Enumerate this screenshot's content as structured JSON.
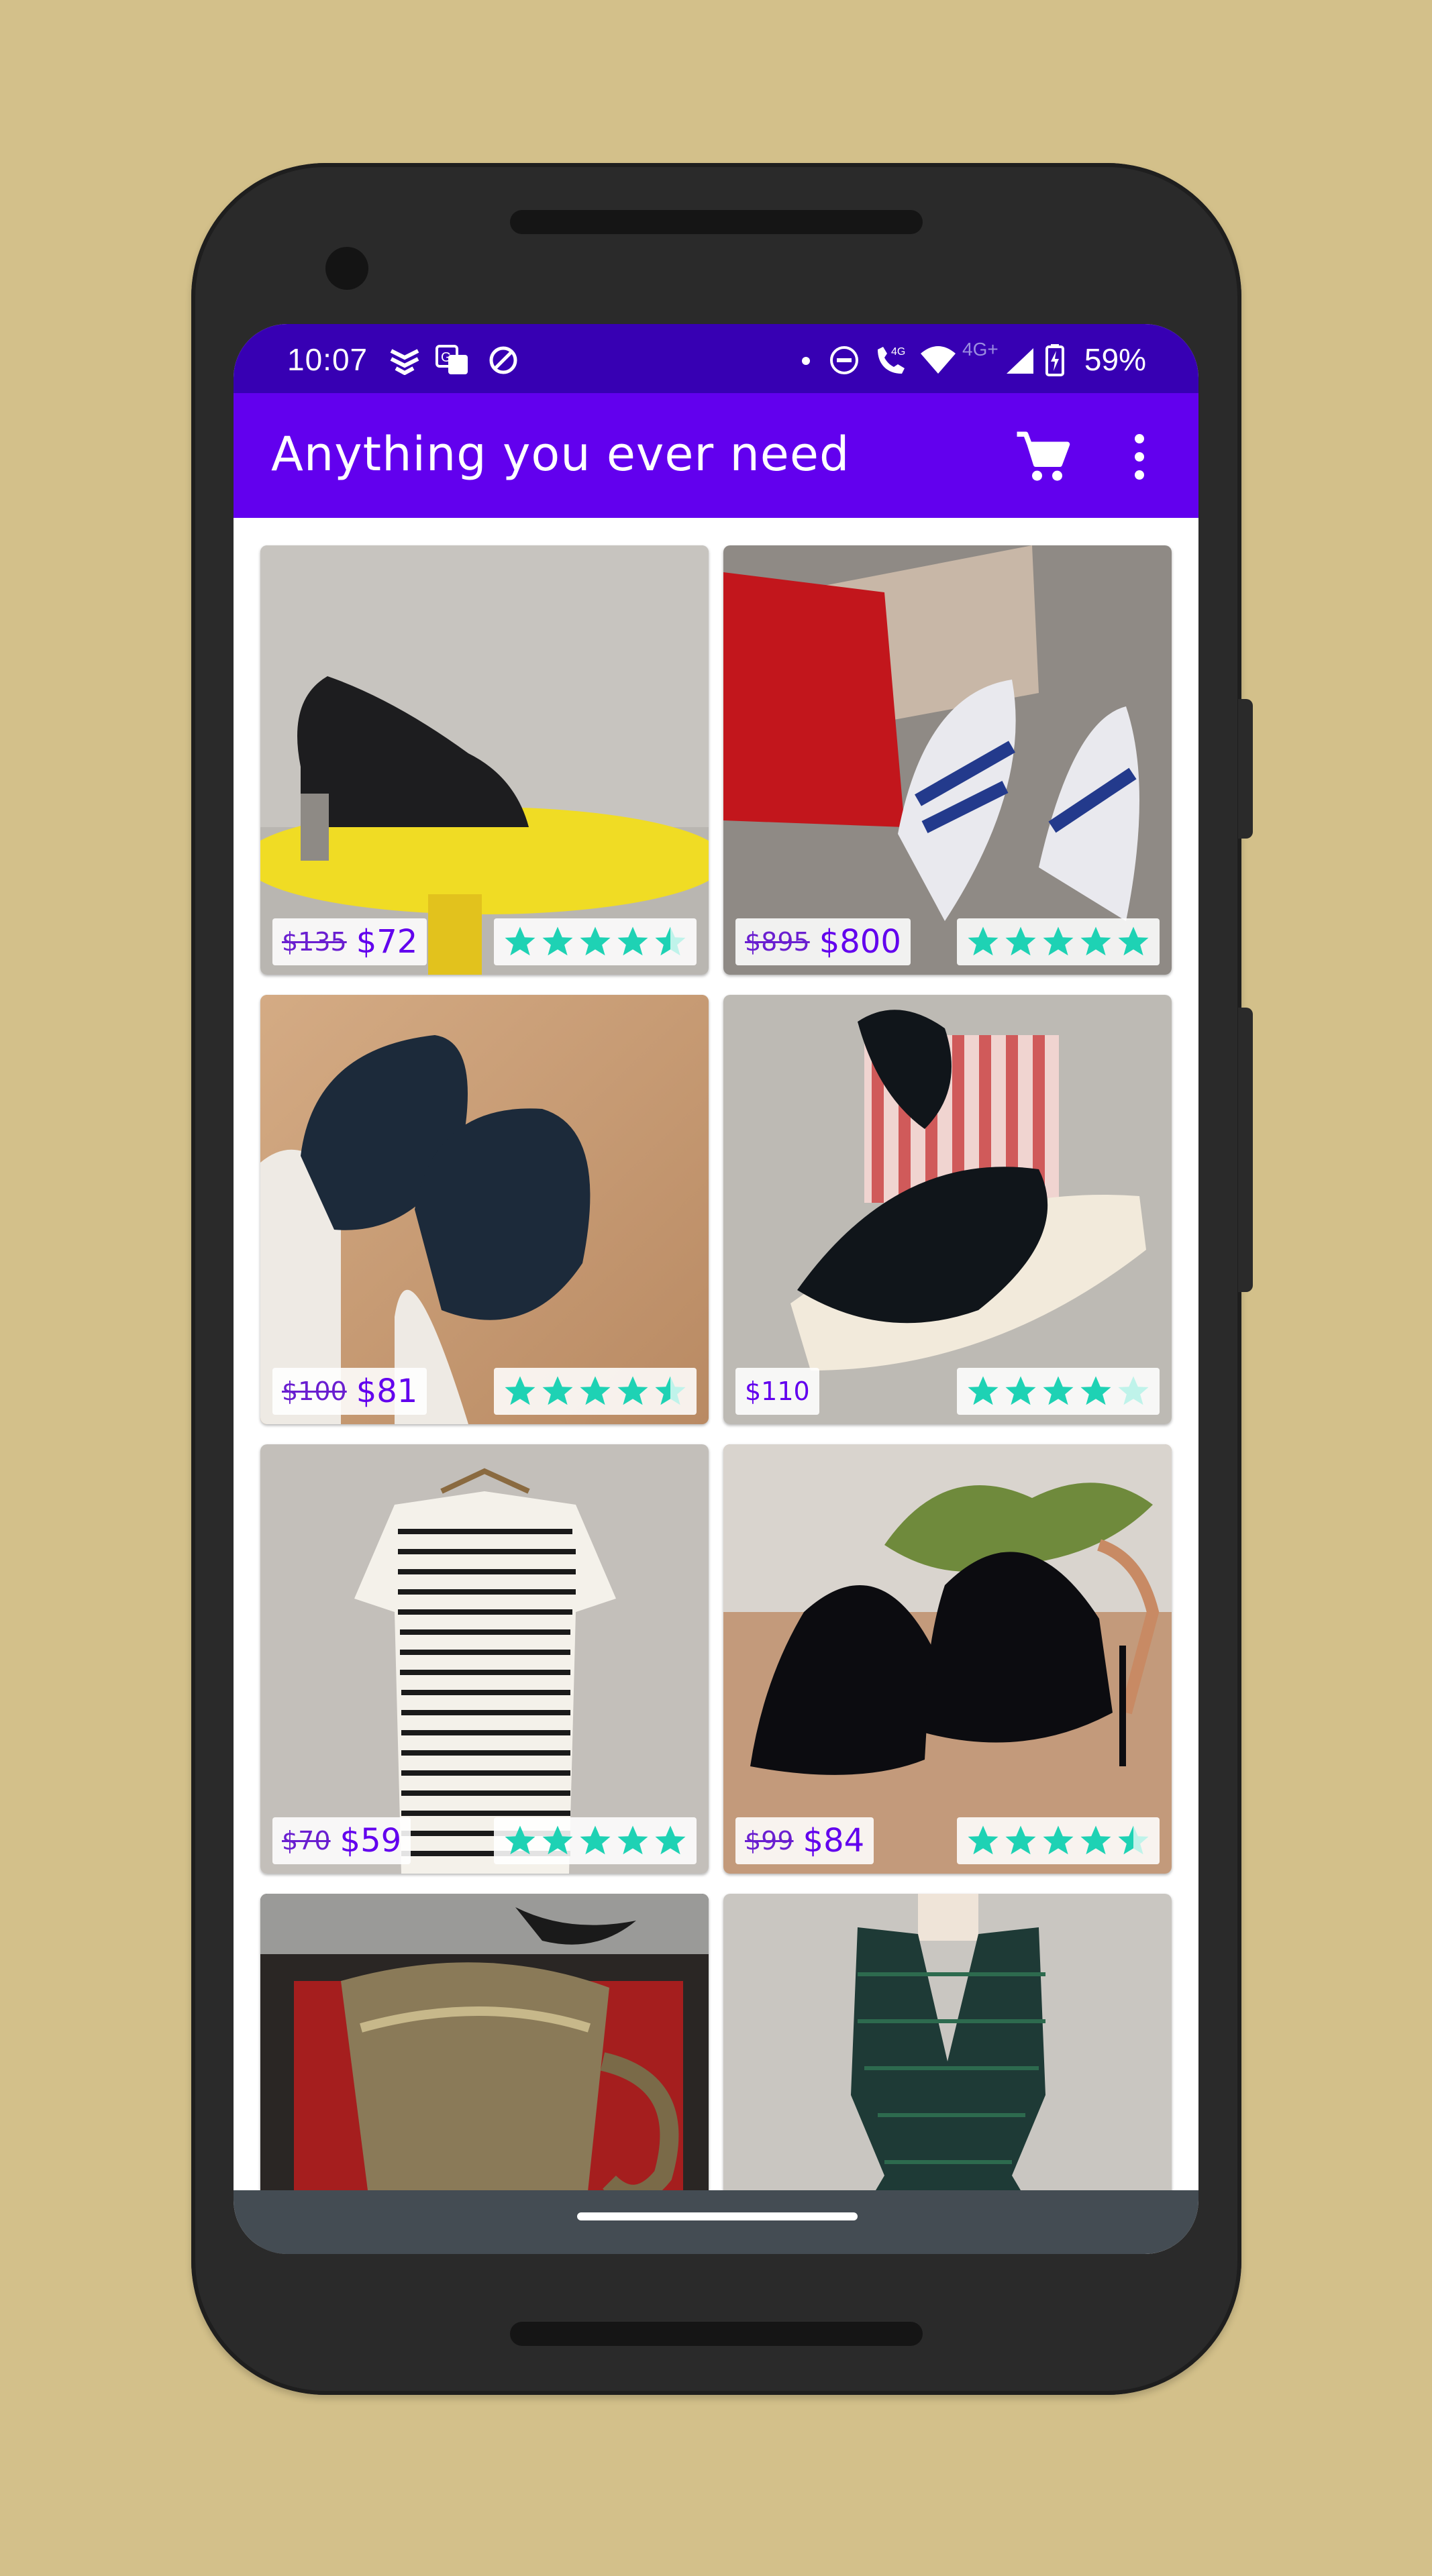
{
  "status": {
    "time": "10:07",
    "network": "4G+",
    "battery": "59%",
    "icons": [
      "notification-icon",
      "translate-icon",
      "data-saver-icon",
      "dot-icon",
      "dnd-icon",
      "wifi-calling-icon",
      "wifi-icon",
      "signal-icon",
      "battery-icon"
    ]
  },
  "appbar": {
    "title": "Anything you ever need",
    "cart_icon": "cart-icon",
    "menu_icon": "more-vert-icon"
  },
  "colors": {
    "primary": "#6200ee",
    "primary_dark": "#3700b3",
    "star": "#1ed2b4",
    "background": "#d3c08a"
  },
  "products": [
    {
      "image": "black woven pump on yellow stool",
      "old_price": "$135",
      "price": "$72",
      "rating": 4.5
    },
    {
      "image": "striped heels with red box",
      "old_price": "$895",
      "price": "$800",
      "rating": 5
    },
    {
      "image": "black leather sneakers on wood floor",
      "old_price": "$100",
      "price": "$81",
      "rating": 4.5
    },
    {
      "image": "black espadrille sandals with striped box",
      "old_price": "",
      "price": "$110",
      "rating": 4
    },
    {
      "image": "striped dress on hanger",
      "old_price": "$70",
      "price": "$59",
      "rating": 5
    },
    {
      "image": "black patent mule heels",
      "old_price": "$99",
      "price": "$84",
      "rating": 4.5
    },
    {
      "image": "engraved silver mug in case",
      "old_price": "",
      "price": "",
      "rating": null
    },
    {
      "image": "green dress on mannequin",
      "old_price": "",
      "price": "",
      "rating": null
    }
  ]
}
